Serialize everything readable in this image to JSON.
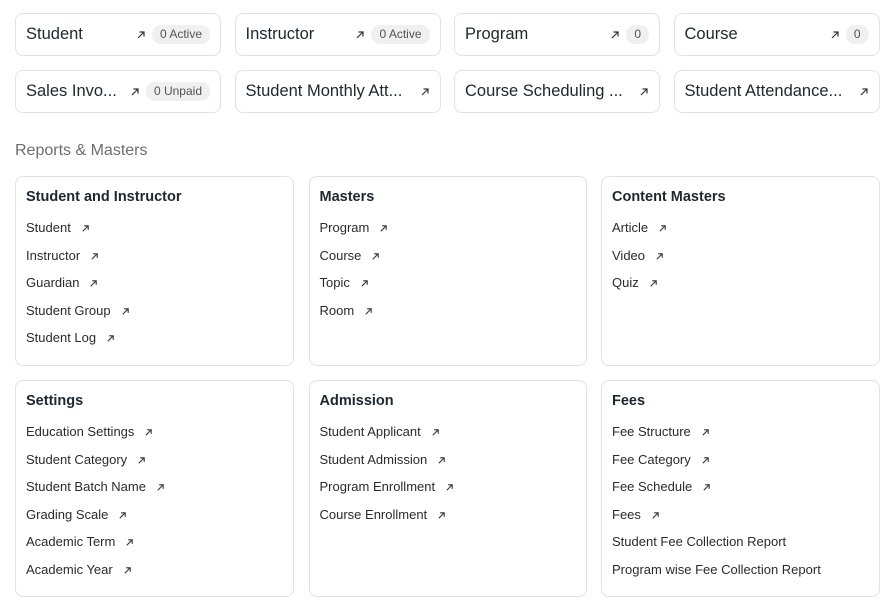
{
  "shortcuts": [
    {
      "label": "Student",
      "badge": "0 Active"
    },
    {
      "label": "Instructor",
      "badge": "0 Active"
    },
    {
      "label": "Program",
      "badge": "0"
    },
    {
      "label": "Course",
      "badge": "0"
    },
    {
      "label": "Sales Invo...",
      "badge": "0 Unpaid"
    },
    {
      "label": "Student Monthly Att...",
      "badge": ""
    },
    {
      "label": "Course Scheduling ...",
      "badge": ""
    },
    {
      "label": "Student Attendance...",
      "badge": ""
    }
  ],
  "section_title": "Reports & Masters",
  "cards": [
    {
      "title": "Student and Instructor",
      "links": [
        "Student",
        "Instructor",
        "Guardian",
        "Student Group",
        "Student Log"
      ]
    },
    {
      "title": "Masters",
      "links": [
        "Program",
        "Course",
        "Topic",
        "Room"
      ]
    },
    {
      "title": "Content Masters",
      "links": [
        "Article",
        "Video",
        "Quiz"
      ]
    },
    {
      "title": "Settings",
      "links": [
        "Education Settings",
        "Student Category",
        "Student Batch Name",
        "Grading Scale",
        "Academic Term",
        "Academic Year"
      ]
    },
    {
      "title": "Admission",
      "links": [
        "Student Applicant",
        "Student Admission",
        "Program Enrollment",
        "Course Enrollment"
      ]
    },
    {
      "title": "Fees",
      "links": [
        "Fee Structure",
        "Fee Category",
        "Fee Schedule",
        "Fees",
        "Student Fee Collection Report",
        "Program wise Fee Collection Report"
      ]
    }
  ],
  "icons": {
    "link": "arrow-up-right-icon"
  },
  "colors": {
    "border": "#e2e2e2",
    "text": "#1f272e",
    "muted": "#6e6e6e",
    "badge_bg": "#f0f0f0"
  }
}
